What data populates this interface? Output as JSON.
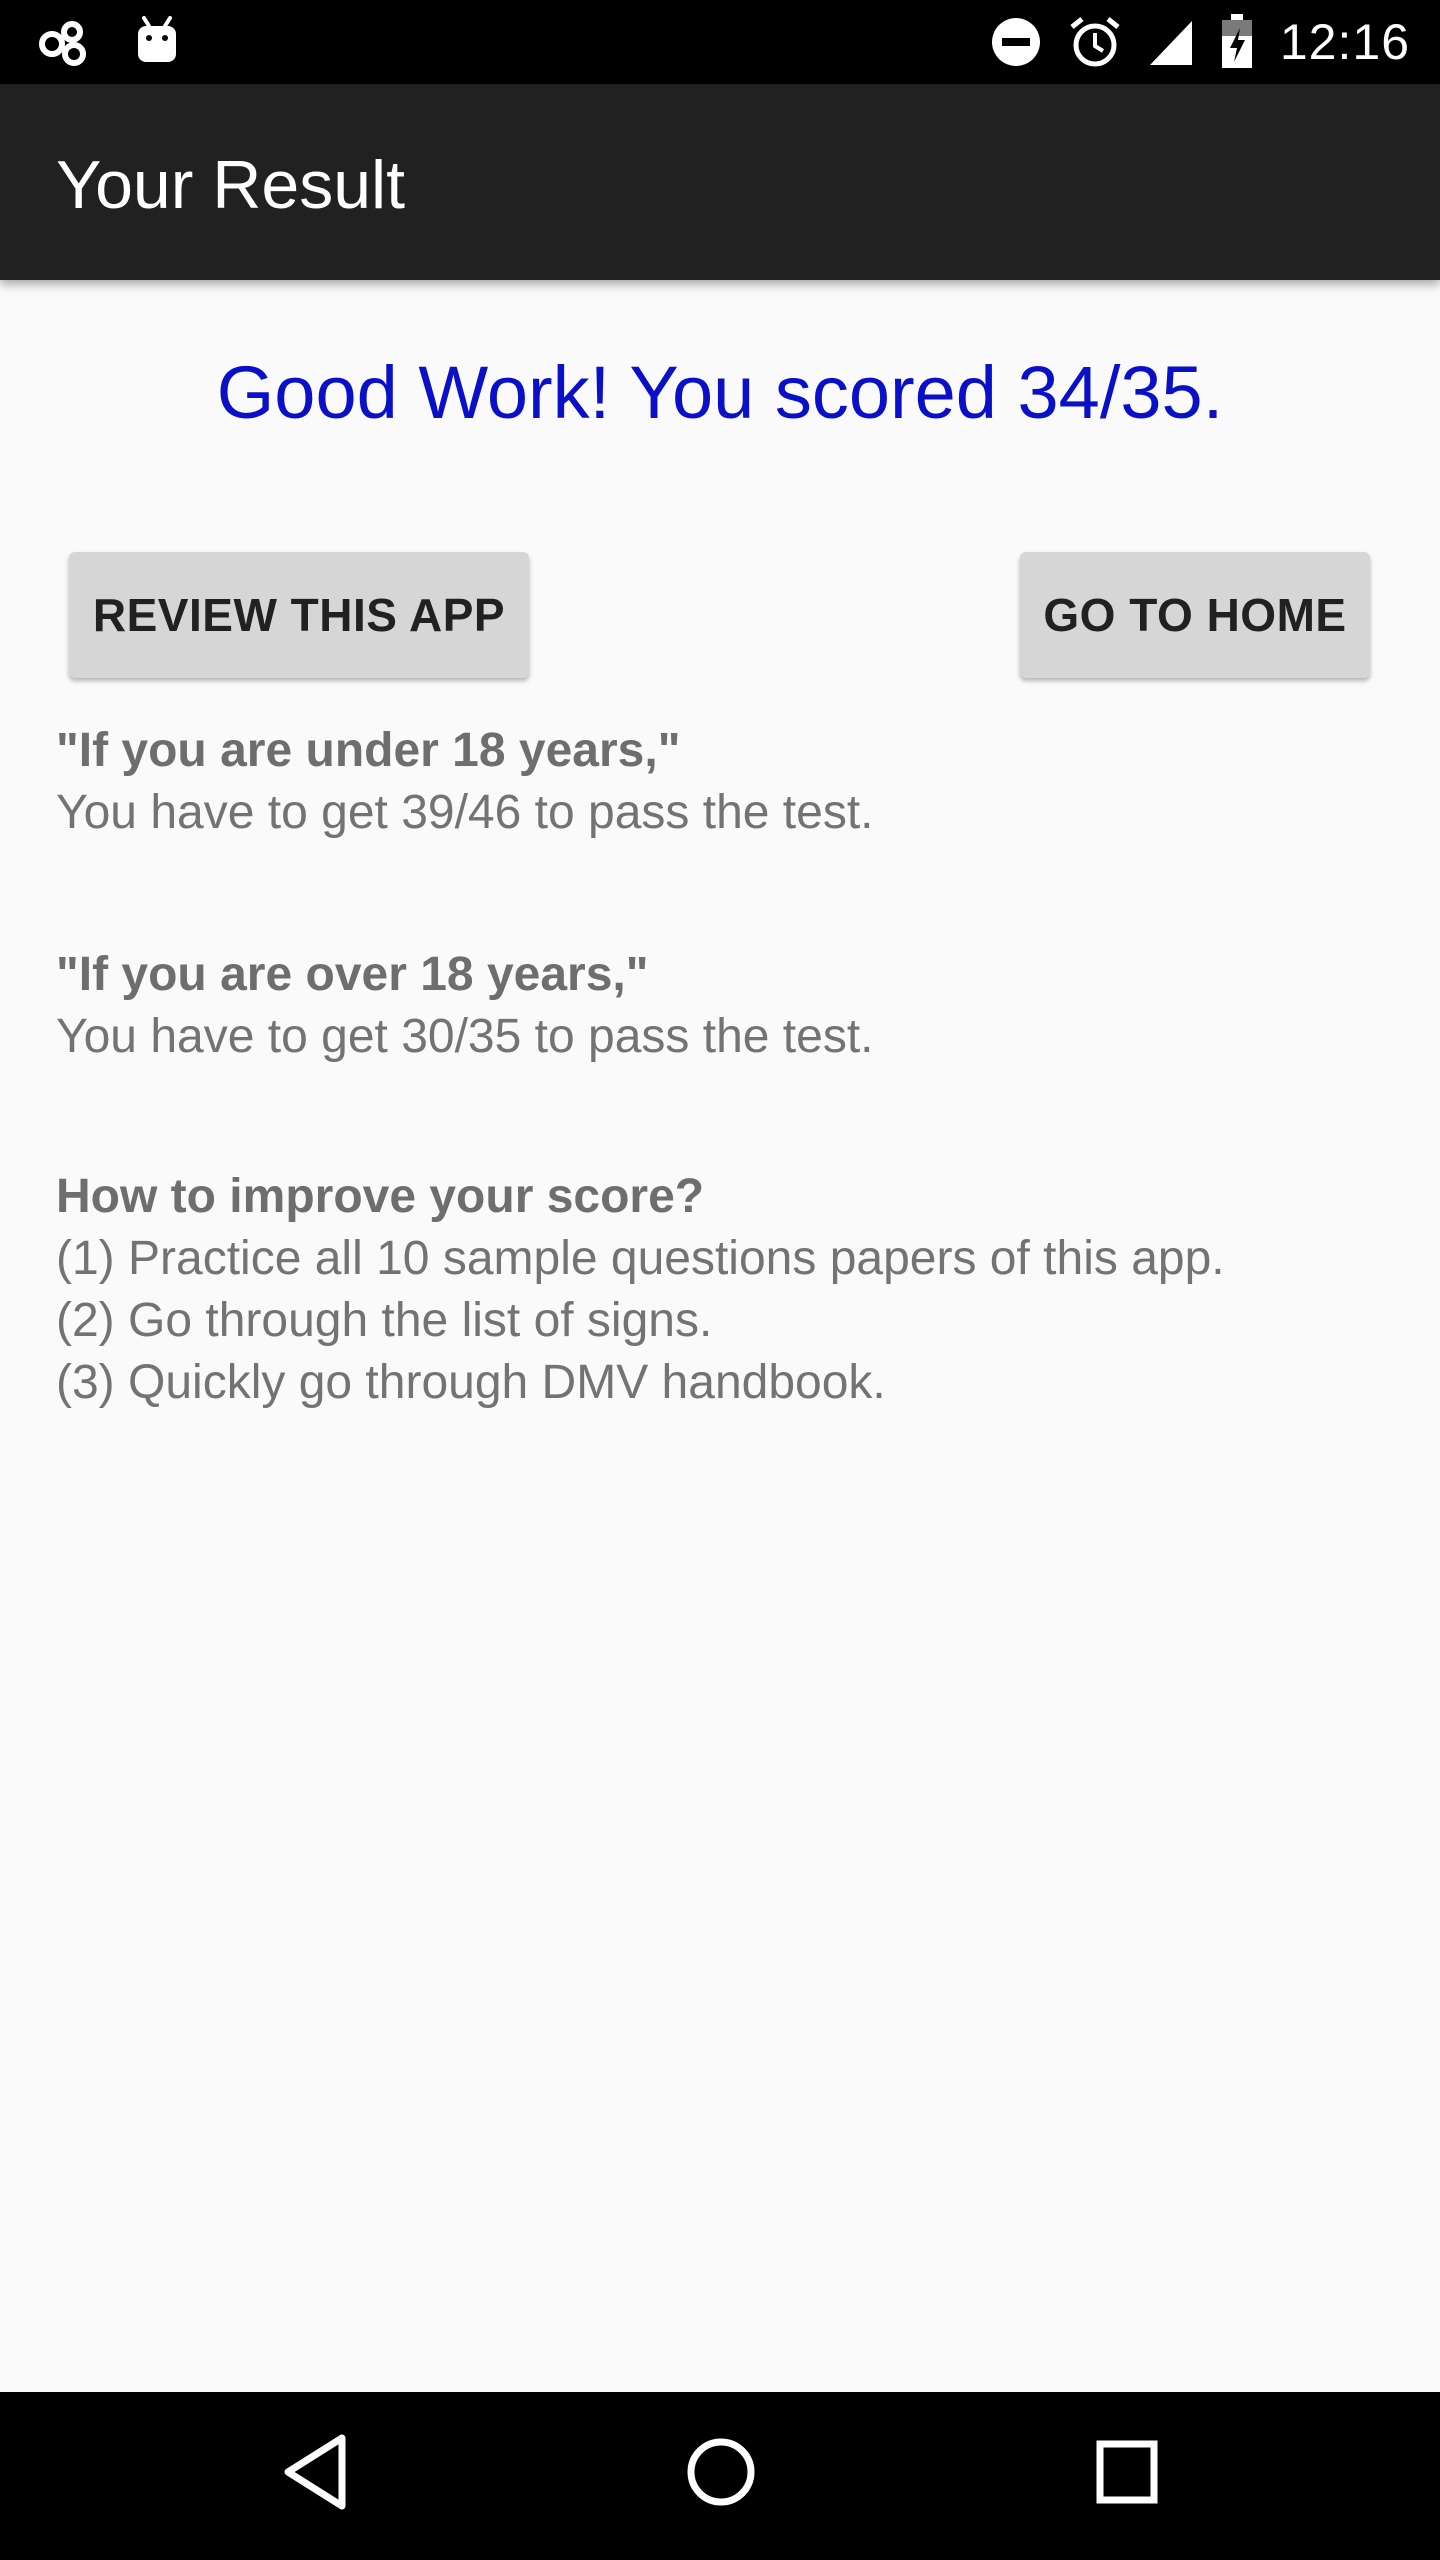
{
  "status_bar": {
    "time": "12:16",
    "left_icons": [
      "infinity-icon",
      "android-icon"
    ],
    "right_icons": [
      "do-not-disturb-icon",
      "alarm-icon",
      "signal-icon",
      "battery-charging-icon"
    ]
  },
  "app_bar": {
    "title": "Your Result"
  },
  "result": {
    "score_message": "Good Work! You scored 34/35."
  },
  "buttons": {
    "review_label": "REVIEW THIS APP",
    "home_label": "GO TO HOME"
  },
  "info": {
    "under_18_heading": "\"If you are under 18 years,\"",
    "under_18_text": "You have to get 39/46 to pass the test.",
    "over_18_heading": "\"If you are over 18 years,\"",
    "over_18_text": "You have to get 30/35 to pass the test.",
    "improve_heading": "How to improve your score?",
    "tips": [
      "(1) Practice all 10 sample questions papers of this app.",
      "(2) Go through the list of signs.",
      "(3) Quickly go through DMV handbook."
    ]
  },
  "nav_bar": {
    "icons": [
      "back-icon",
      "home-icon",
      "recents-icon"
    ]
  },
  "colors": {
    "score": "#0a10c8",
    "app_bar": "#212121",
    "button_bg": "#d6d6d6",
    "info_text": "#737373"
  }
}
